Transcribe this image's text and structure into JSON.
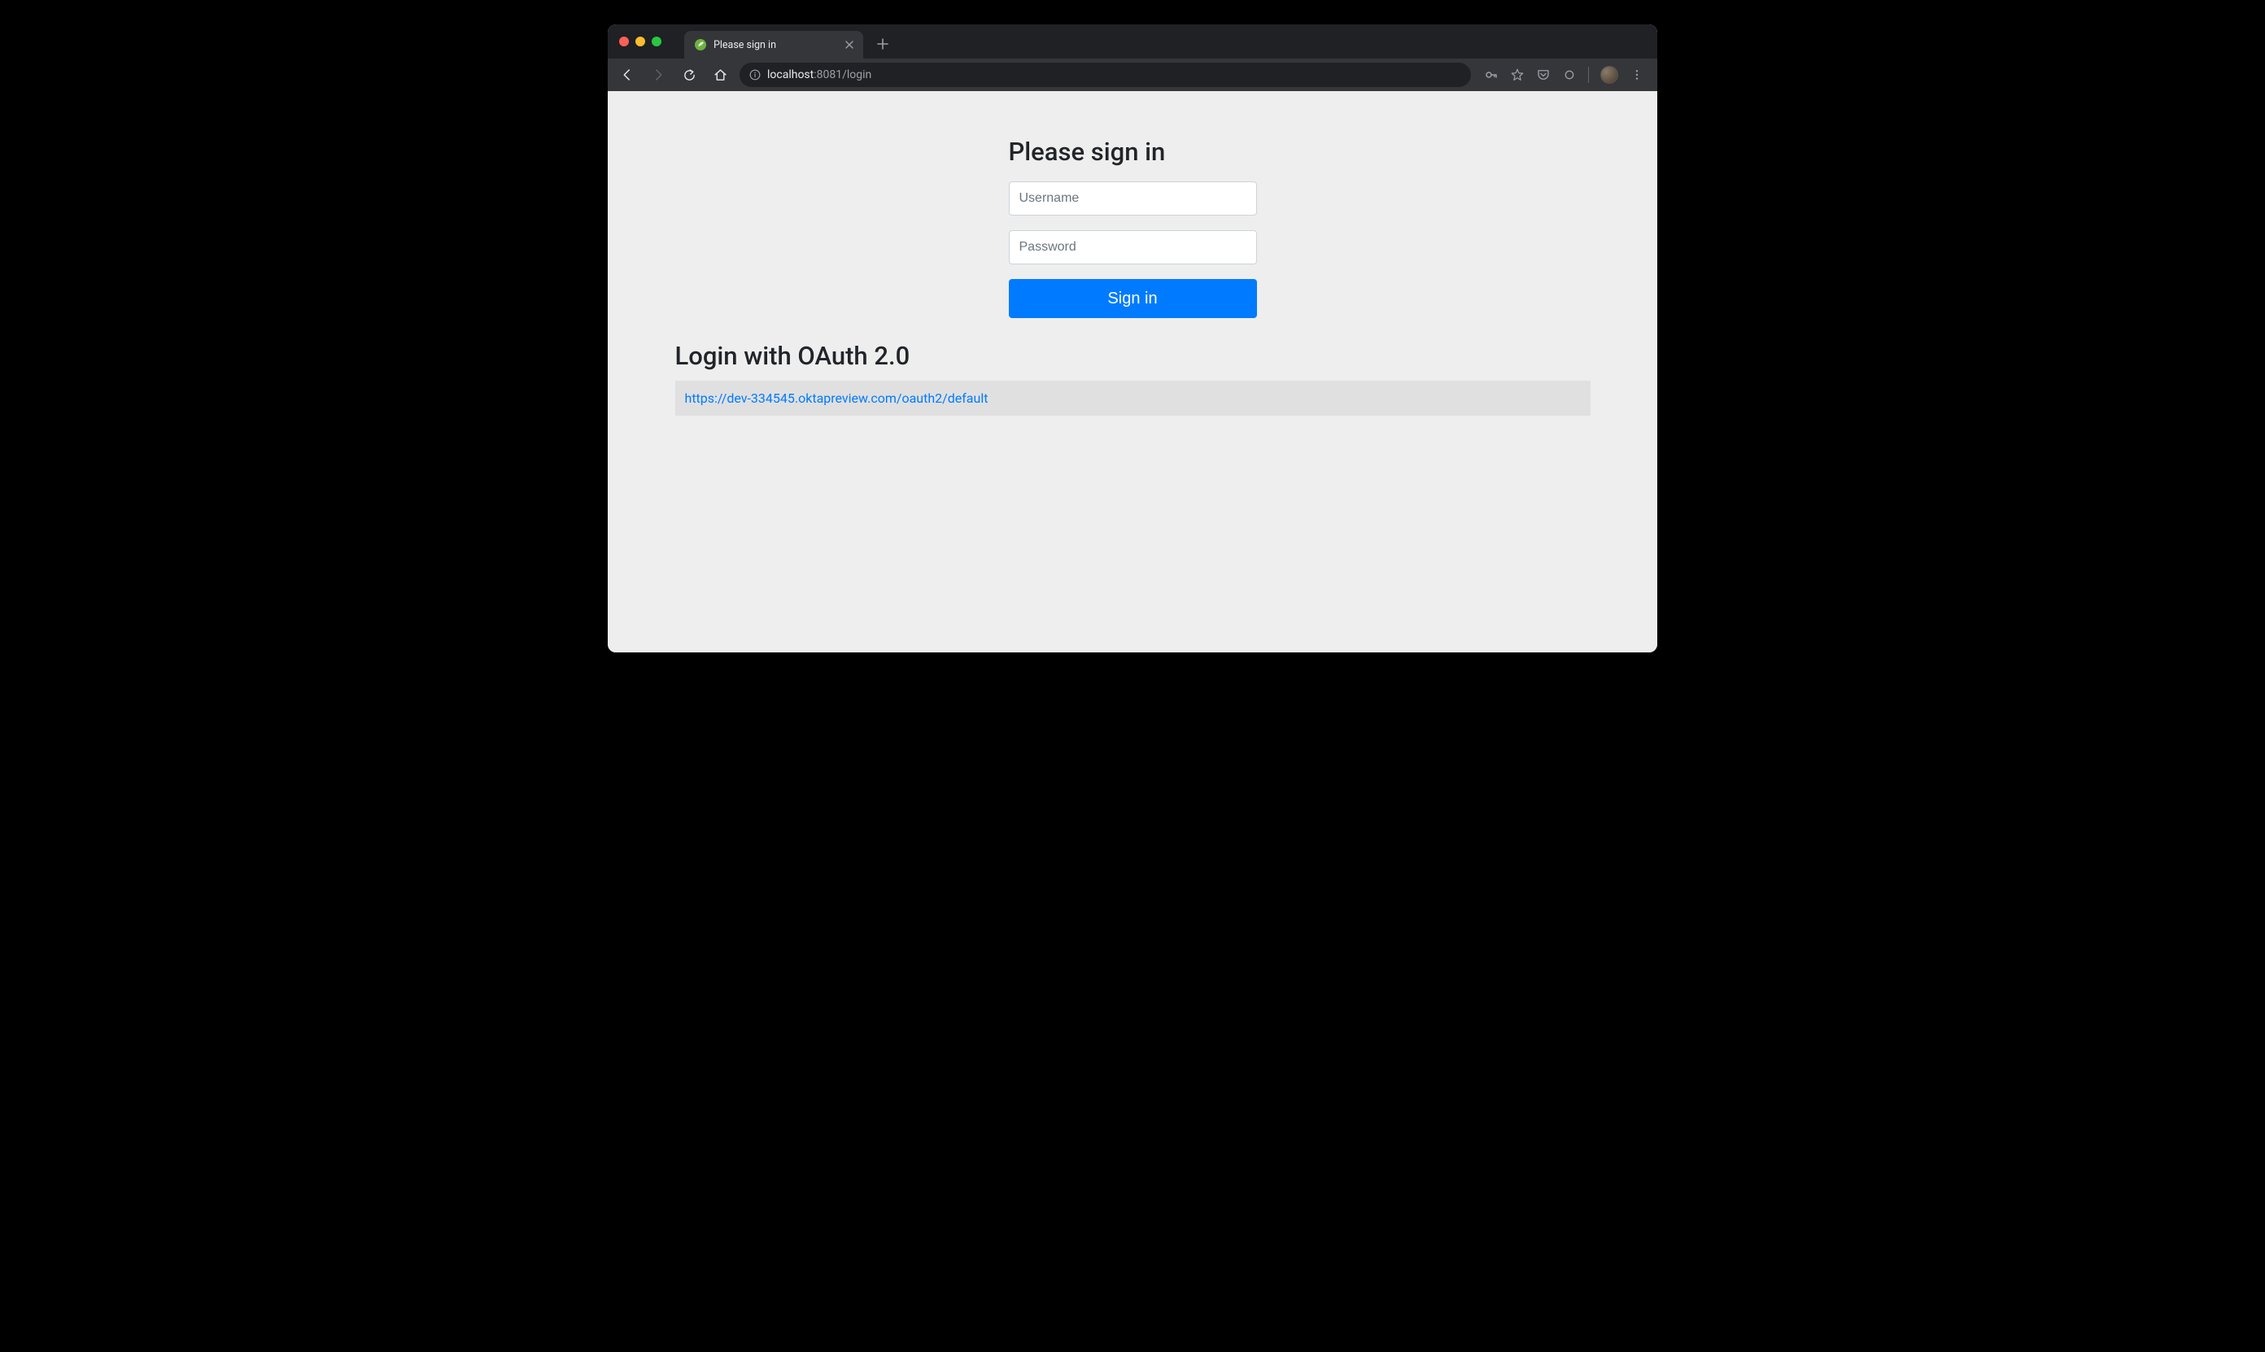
{
  "browser": {
    "tab_title": "Please sign in",
    "url_host": "localhost",
    "url_rest": ":8081/login"
  },
  "page": {
    "heading": "Please sign in",
    "username_placeholder": "Username",
    "password_placeholder": "Password",
    "submit_label": "Sign in",
    "oauth_heading": "Login with OAuth 2.0",
    "oauth_provider_label": "https://dev-334545.oktapreview.com/oauth2/default"
  }
}
